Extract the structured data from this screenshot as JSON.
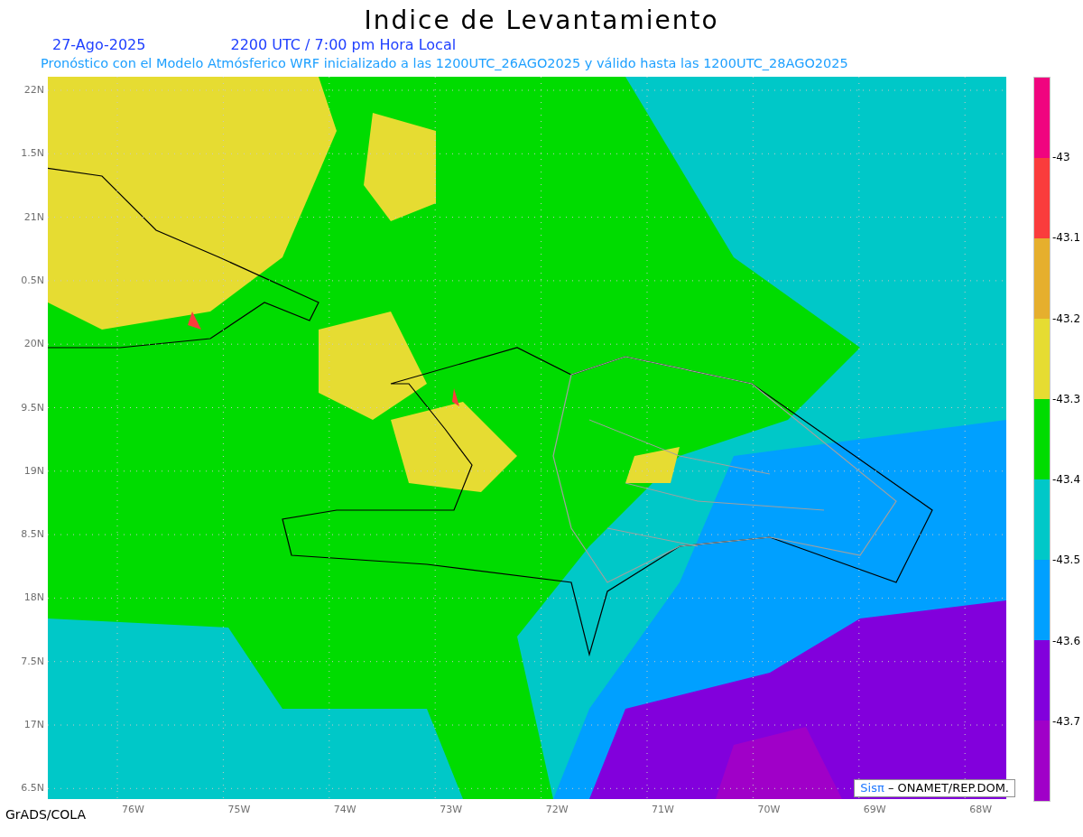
{
  "title": "Indice de Levantamiento",
  "date": "27-Ago-2025",
  "time": "2200 UTC / 7:00 pm Hora Local",
  "subtitle": "Pronóstico con el Modelo Atmósferico WRF inicializado a las 1200UTC_26AGO2025 y válido hasta las  1200UTC_28AGO2025",
  "y_labels": [
    "22N",
    "1.5N",
    "21N",
    "0.5N",
    "20N",
    "9.5N",
    "19N",
    "8.5N",
    "18N",
    "7.5N",
    "17N",
    "6.5N"
  ],
  "x_labels": [
    "76W",
    "75W",
    "74W",
    "73W",
    "72W",
    "71W",
    "70W",
    "69W",
    "68W"
  ],
  "colorbar": {
    "segments": [
      {
        "color": "#f0047f"
      },
      {
        "color": "#fa3c3c"
      },
      {
        "color": "#e6af2d"
      },
      {
        "color": "#e6dc32"
      },
      {
        "color": "#00dc00"
      },
      {
        "color": "#00c8c8"
      },
      {
        "color": "#00a0ff"
      },
      {
        "color": "#8200dc"
      },
      {
        "color": "#a000c8"
      }
    ],
    "labels": [
      "-43",
      "-43.1",
      "-43.2",
      "-43.3",
      "-43.4",
      "-43.5",
      "-43.6",
      "-43.7"
    ]
  },
  "credit": {
    "brand": "Sisπ",
    "text": "– ONAMET/REP.DOM."
  },
  "footer": "GrADS/COLA"
}
